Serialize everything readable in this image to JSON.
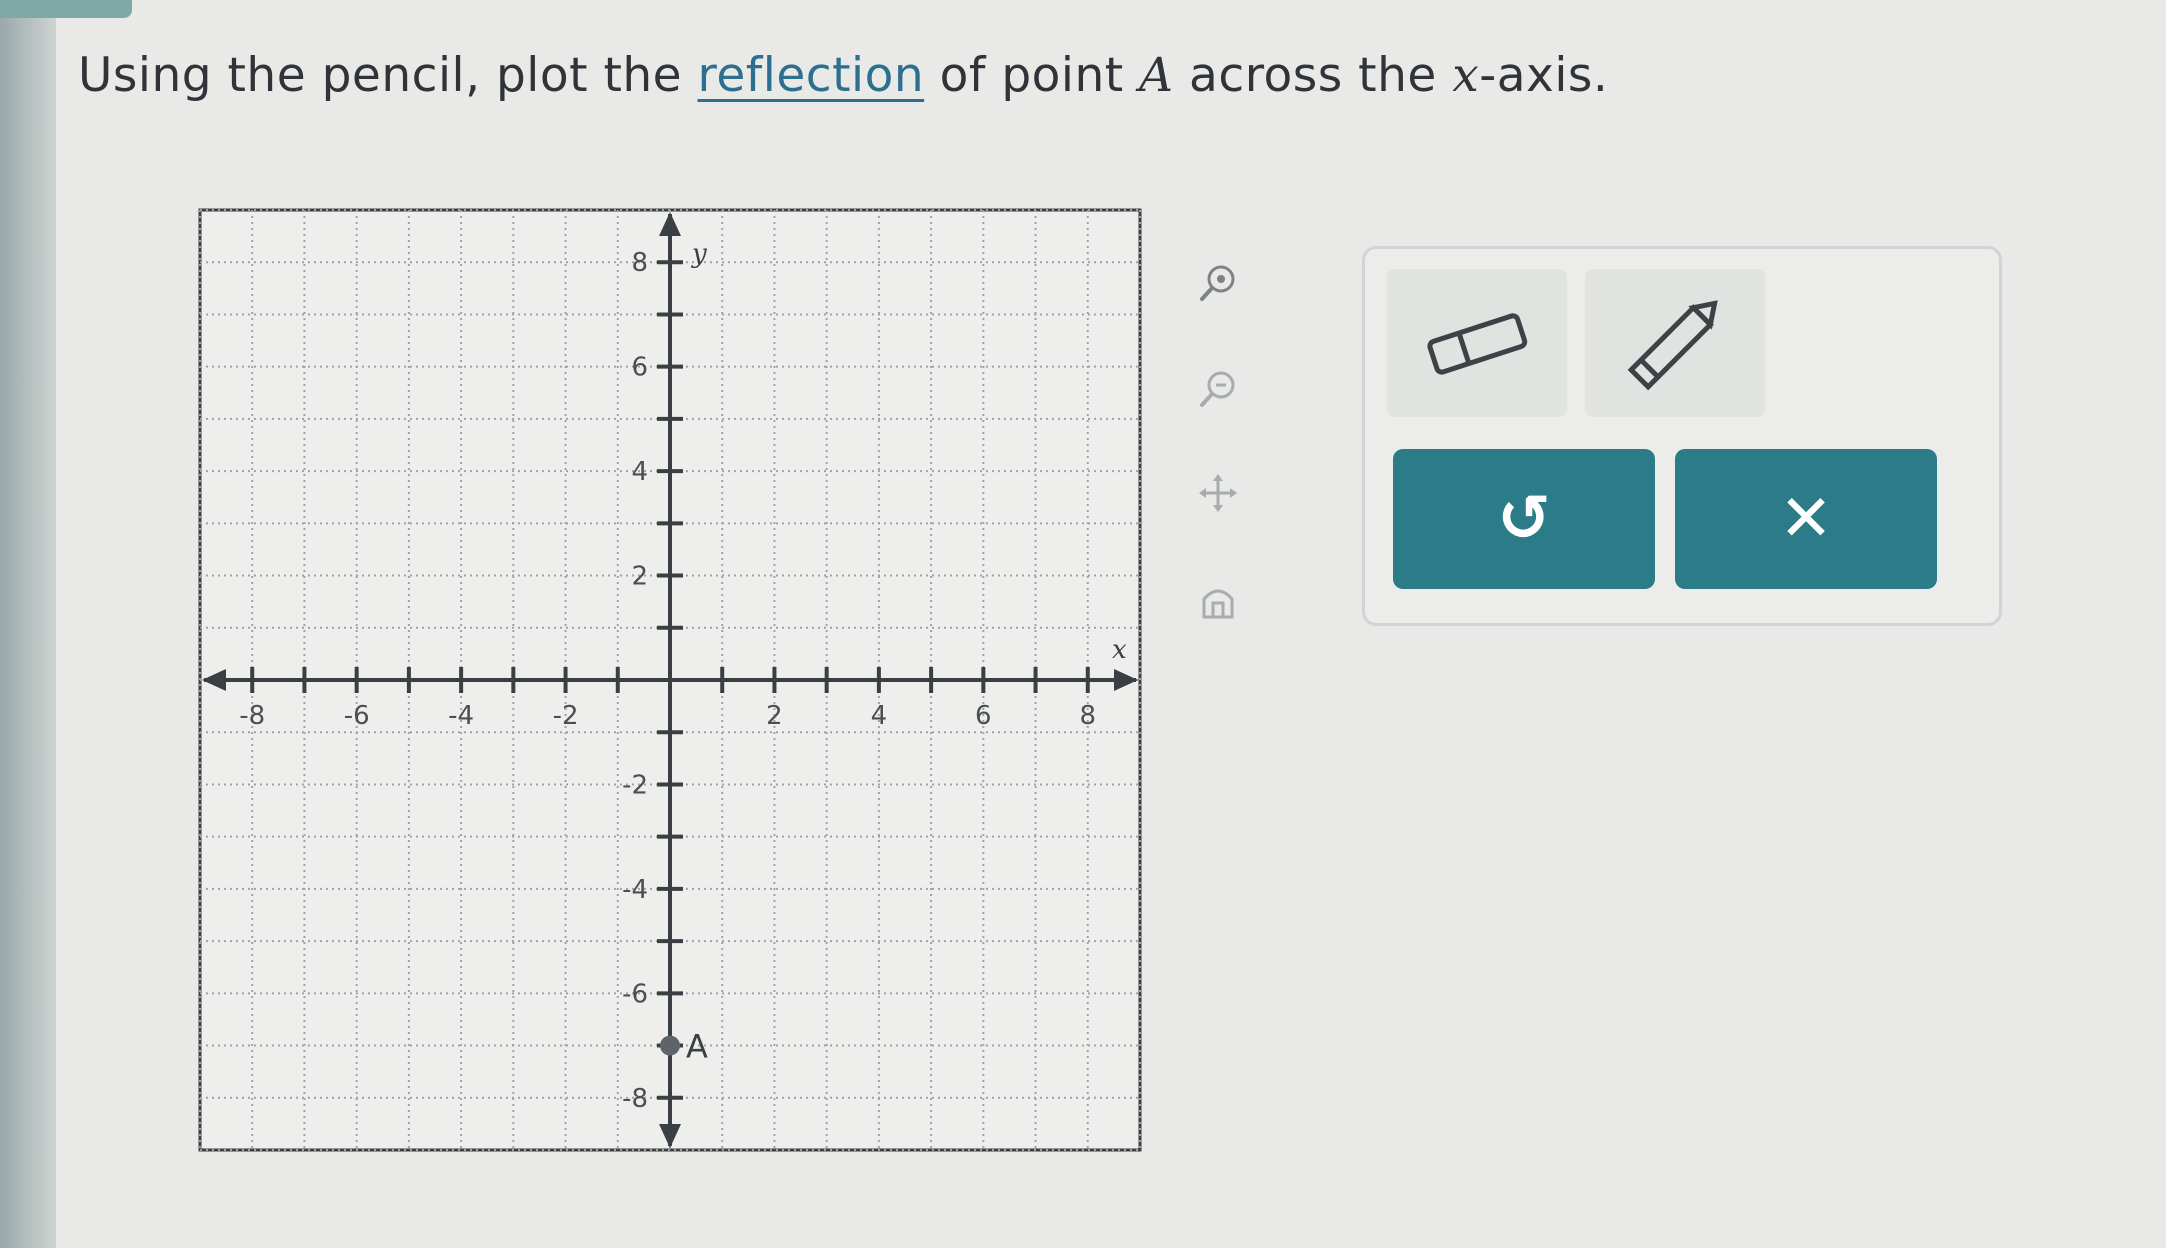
{
  "question": {
    "part1": "Using the pencil, plot the ",
    "link": "reflection",
    "part2": " of point ",
    "point_var": "A",
    "part3": " across the ",
    "axis_var": "x",
    "part4": "-axis."
  },
  "graph": {
    "x_axis_label": "x",
    "y_axis_label": "y",
    "range": [
      -9,
      9
    ],
    "x_tick_labels": [
      "-8",
      "-6",
      "-4",
      "-2",
      "2",
      "4",
      "6",
      "8"
    ],
    "y_tick_labels": [
      "8",
      "6",
      "4",
      "2",
      "-2",
      "-4",
      "-6",
      "-8"
    ],
    "point": {
      "label": "A",
      "x": 0,
      "y": -7
    },
    "colors": {
      "point": "#5e6468",
      "axis": "#3a3f44",
      "grid": "#9ea4a6"
    }
  },
  "side_controls": {
    "zoom_in": "zoom-in-icon",
    "zoom_out": "zoom-out-icon",
    "pan": "pan-icon",
    "home": "home-icon"
  },
  "tools": {
    "eraser": "eraser-icon",
    "pencil": "pencil-icon",
    "undo_glyph": "↺",
    "clear_glyph": "✕",
    "accent": "#2b7c88"
  }
}
